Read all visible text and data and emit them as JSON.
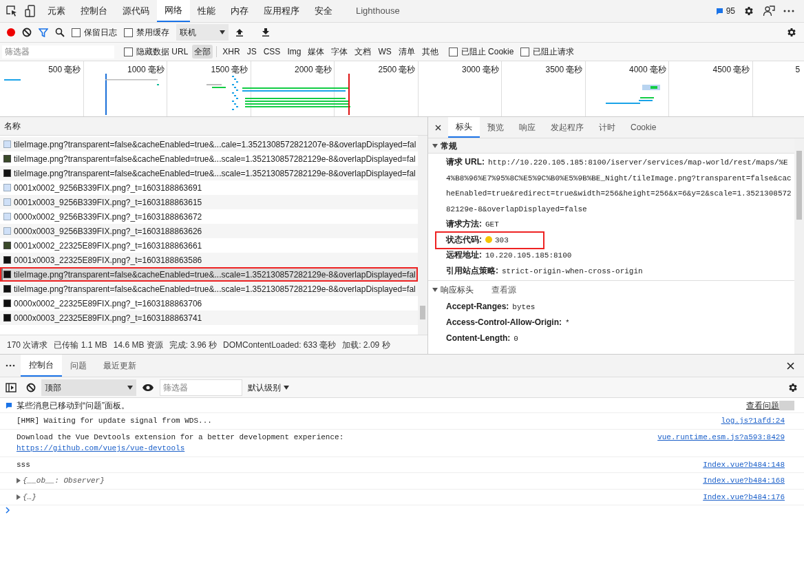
{
  "main_tabs": [
    {
      "label": "元素",
      "selected": false
    },
    {
      "label": "控制台",
      "selected": false
    },
    {
      "label": "源代码",
      "selected": false
    },
    {
      "label": "网络",
      "selected": true
    },
    {
      "label": "性能",
      "selected": false
    },
    {
      "label": "内存",
      "selected": false
    },
    {
      "label": "应用程序",
      "selected": false
    },
    {
      "label": "安全",
      "selected": false
    },
    {
      "label": "Lighthouse",
      "selected": false
    }
  ],
  "issues_count": "95",
  "network_toolbar": {
    "recording": true,
    "checkboxes": [
      {
        "label": "保留日志",
        "checked": false
      },
      {
        "label": "禁用缓存",
        "checked": false
      }
    ],
    "throttle": "联机"
  },
  "filter_bar": {
    "placeholder": "筛选器",
    "hide_data_url": {
      "label": "隐藏数据 URL",
      "checked": false
    },
    "types": [
      {
        "label": "全部",
        "selected": true
      },
      {
        "label": "XHR",
        "selected": false
      },
      {
        "label": "JS",
        "selected": false
      },
      {
        "label": "CSS",
        "selected": false
      },
      {
        "label": "Img",
        "selected": false
      },
      {
        "label": "媒体",
        "selected": false
      },
      {
        "label": "字体",
        "selected": false
      },
      {
        "label": "文档",
        "selected": false
      },
      {
        "label": "WS",
        "selected": false
      },
      {
        "label": "清单",
        "selected": false
      },
      {
        "label": "其他",
        "selected": false
      }
    ],
    "blocked": [
      {
        "label": "已阻止 Cookie",
        "checked": false
      },
      {
        "label": "已阻止请求",
        "checked": false
      }
    ]
  },
  "overview_ticks": [
    "500 毫秒",
    "1000 毫秒",
    "1500 毫秒",
    "2000 毫秒",
    "2500 毫秒",
    "3000 毫秒",
    "3500 毫秒",
    "4000 毫秒",
    "4500 毫秒",
    "5"
  ],
  "requests": {
    "column": "名称",
    "rows": [
      {
        "name": "tileImage.png?transparent=false&cacheEnabled=true&...cale=1.3521308572821207e-8&overlapDisplayed=fal",
        "kind": "light",
        "selected": false
      },
      {
        "name": "tileImage.png?transparent=false&cacheEnabled=true&...scale=1.352130857282129e-8&overlapDisplayed=fal",
        "kind": "map",
        "selected": false
      },
      {
        "name": "tileImage.png?transparent=false&cacheEnabled=true&...scale=1.352130857282129e-8&overlapDisplayed=fal",
        "kind": "dark",
        "selected": false
      },
      {
        "name": "0001x0002_9256B339FIX.png?_t=1603188863691",
        "kind": "light",
        "selected": false
      },
      {
        "name": "0001x0003_9256B339FIX.png?_t=1603188863615",
        "kind": "light",
        "selected": false
      },
      {
        "name": "0000x0002_9256B339FIX.png?_t=1603188863672",
        "kind": "light",
        "selected": false
      },
      {
        "name": "0000x0003_9256B339FIX.png?_t=1603188863626",
        "kind": "light",
        "selected": false
      },
      {
        "name": "0001x0002_22325E89FIX.png?_t=1603188863661",
        "kind": "map",
        "selected": false
      },
      {
        "name": "0001x0003_22325E89FIX.png?_t=1603188863586",
        "kind": "dark",
        "selected": false
      },
      {
        "name": "tileImage.png?transparent=false&cacheEnabled=true&...scale=1.352130857282129e-8&overlapDisplayed=fal",
        "kind": "dark",
        "selected": true
      },
      {
        "name": "tileImage.png?transparent=false&cacheEnabled=true&...scale=1.352130857282129e-8&overlapDisplayed=fal",
        "kind": "dark",
        "selected": false
      },
      {
        "name": "0000x0002_22325E89FIX.png?_t=1603188863706",
        "kind": "dark",
        "selected": false
      },
      {
        "name": "0000x0003_22325E89FIX.png?_t=1603188863741",
        "kind": "dark",
        "selected": false
      }
    ]
  },
  "summary": [
    "170 次请求",
    "已传输 1.1 MB",
    "14.6 MB 资源",
    "完成: 3.96 秒",
    "DOMContentLoaded: 633 毫秒",
    "加载: 2.09 秒"
  ],
  "detail_tabs": [
    {
      "label": "标头",
      "selected": true
    },
    {
      "label": "预览",
      "selected": false
    },
    {
      "label": "响应",
      "selected": false
    },
    {
      "label": "发起程序",
      "selected": false
    },
    {
      "label": "计时",
      "selected": false
    },
    {
      "label": "Cookie",
      "selected": false
    }
  ],
  "general": {
    "title": "常规",
    "expanded": true,
    "fields": [
      {
        "label": "请求 URL:",
        "value": "http://10.220.105.185:8100/iserver/services/map-world/rest/maps/%E4%B8%96%E7%95%8C%E5%9C%B0%E5%9B%BE_Night/tileImage.png?transparent=false&cacheEnabled=true&redirect=true&width=256&height=256&x=6&y=2&scale=1.352130857282129e-8&overlapDisplayed=false",
        "highlighted": false
      },
      {
        "label": "请求方法:",
        "value": "GET",
        "highlighted": false
      },
      {
        "label": "状态代码:",
        "value": "303",
        "color": "#f5c400",
        "highlighted": true
      },
      {
        "label": "远程地址:",
        "value": "10.220.105.185:8100",
        "highlighted": false
      },
      {
        "label": "引用站点策略:",
        "value": "strict-origin-when-cross-origin",
        "highlighted": false
      }
    ]
  },
  "response_headers": {
    "title": "响应标头",
    "view_source": "查看源",
    "expanded": true,
    "fields": [
      {
        "label": "Accept-Ranges:",
        "value": "bytes"
      },
      {
        "label": "Access-Control-Allow-Origin:",
        "value": "*"
      },
      {
        "label": "Content-Length:",
        "value": "0"
      }
    ]
  },
  "drawer_tabs": [
    {
      "label": "控制台",
      "selected": true
    },
    {
      "label": "问题",
      "selected": false
    },
    {
      "label": "最近更新",
      "selected": false
    }
  ],
  "console_toolbar": {
    "context": "顶部",
    "filter_placeholder": "筛选器",
    "level": "默认级别"
  },
  "issues_banner": {
    "text": "某些消息已移动到“问题”面板。",
    "button": "查看问题"
  },
  "console_messages": [
    {
      "kind": "log",
      "text": "[HMR] Waiting for update signal from WDS...",
      "source": "log.js?1afd:24"
    },
    {
      "kind": "log",
      "text": "Download the Vue Devtools extension for a better development experience:",
      "link": "https://github.com/vuejs/vue-devtools",
      "source": "vue.runtime.esm.js?a593:8429"
    },
    {
      "kind": "log",
      "text": "sss",
      "source": "Index.vue?b484:148"
    },
    {
      "kind": "object",
      "text": "{__ob__: Observer}",
      "source": "Index.vue?b484:168"
    },
    {
      "kind": "object",
      "text": "{…}",
      "source": "Index.vue?b484:176"
    }
  ]
}
